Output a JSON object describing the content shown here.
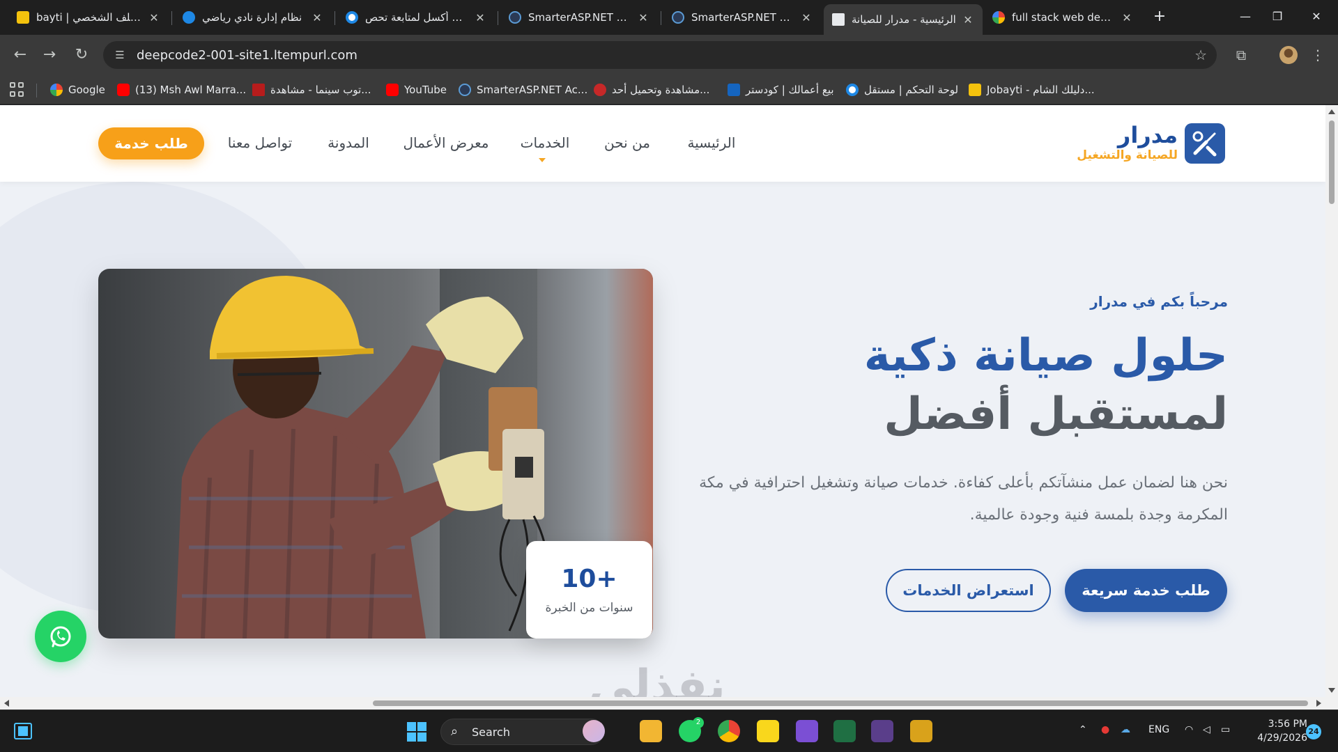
{
  "browser": {
    "tabs": [
      {
        "title": "bayti | الملف الشخصي",
        "favicon": "jobayti-icon",
        "active": false
      },
      {
        "title": "نظام إدارة نادي رياضي",
        "favicon": "app-icon",
        "active": false
      },
      {
        "title": "ملف أكسل لمتابعة تحص",
        "favicon": "circle-icon",
        "active": false
      },
      {
        "title": "SmarterASP.NET Acco",
        "favicon": "smarterasp-icon",
        "active": false
      },
      {
        "title": "SmarterASP.NET Acco",
        "favicon": "smarterasp-icon",
        "active": false
      },
      {
        "title": "الرئيسية - مدرار للصيانة",
        "favicon": "page-icon",
        "active": true
      },
      {
        "title": "full stack web dev - ف",
        "favicon": "google-icon",
        "active": false
      }
    ],
    "new_tab_label": "+",
    "window_controls": {
      "minimize": "—",
      "restore": "❐",
      "close": "✕"
    },
    "url": "deepcode2-001-site1.ltempurl.com",
    "bookmarks": [
      {
        "label": "Google",
        "icon": "google-icon"
      },
      {
        "label": "(13) Msh Awl Marra...",
        "icon": "youtube-icon"
      },
      {
        "label": "توب سينما - مشاهدة...",
        "icon": "top-icon"
      },
      {
        "label": "YouTube",
        "icon": "youtube-icon"
      },
      {
        "label": "SmarterASP.NET Ac...",
        "icon": "smarterasp-icon"
      },
      {
        "label": "مشاهدة وتحميل أحد...",
        "icon": "movie-icon"
      },
      {
        "label": "بيع أعمالك | كودستر",
        "icon": "codester-icon"
      },
      {
        "label": "لوحة التحكم | مستقل",
        "icon": "mostaql-icon"
      },
      {
        "label": "Jobayti - دليلك الشام...",
        "icon": "jobayti-icon"
      }
    ]
  },
  "site": {
    "logo": {
      "name": "مدرار",
      "subtitle": "للصيانة والتشغيل",
      "icon": "tools-icon"
    },
    "nav": {
      "home": "الرئيسية",
      "about": "من نحن",
      "services": "الخدمات",
      "portfolio": "معرض الأعمال",
      "blog": "المدونة",
      "contact": "تواصل معنا",
      "cta": "طلب خدمة"
    },
    "hero": {
      "welcome": "مرحباً بكم في مدرار",
      "headline_line1": "حلول صيانة ذكية",
      "headline_line2": "لمستقبل أفضل",
      "description": "نحن هنا لضمان عمل منشآتكم بأعلى كفاءة. خدمات صيانة وتشغيل احترافية في مكة المكرمة وجدة بلمسة فنية وجودة عالمية.",
      "primary_button": "طلب خدمة سريعة",
      "secondary_button": "استعراض الخدمات",
      "image_alt": "electrician-worker-photo"
    },
    "stat": {
      "value": "10+",
      "label": "سنوات من الخبرة"
    },
    "whatsapp_icon": "whatsapp-icon",
    "watermark": "نفذلي"
  },
  "taskbar": {
    "search_label": "Search",
    "whatsapp_badge": "2",
    "language": "ENG",
    "time": "3:56 PM",
    "date": "4/29/2026",
    "notifications": "24"
  },
  "colors": {
    "brand_blue": "#2a5aa8",
    "accent_orange": "#f7a019",
    "whatsapp_green": "#25d366"
  }
}
